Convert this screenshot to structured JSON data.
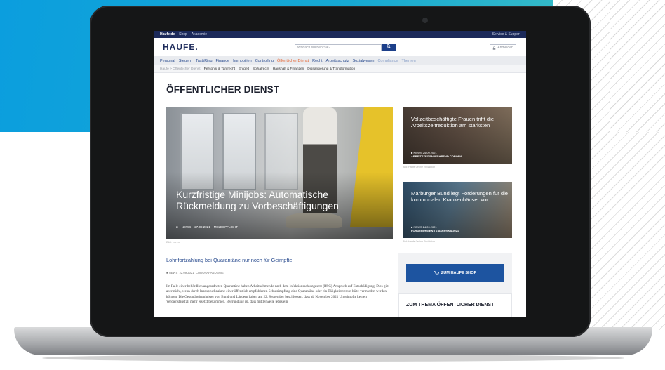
{
  "topbar": {
    "links": [
      "Haufe.de",
      "Shop",
      "Akademie"
    ],
    "right": "Service & Support"
  },
  "header": {
    "logo": "HAUFE.",
    "search_placeholder": "Wonach suchen Sie?",
    "login": "Anmelden"
  },
  "mainnav": {
    "items": [
      "Personal",
      "Steuern",
      "Tax&Ring",
      "Finance",
      "Immobilien",
      "Controlling",
      "Öffentlicher Dienst",
      "Recht",
      "Arbeitsschutz",
      "Sozialwesen",
      "Compliance",
      "Themen"
    ],
    "active_index": 6
  },
  "subnav": {
    "crumb": "Haufe > Öffentlicher Dienst",
    "items": [
      "Personal & Tarifrecht",
      "Entgelt",
      "Sozialrecht",
      "Haushalt & Finanzen",
      "Digitalisierung & Transformation"
    ]
  },
  "page": {
    "title": "ÖFFENTLICHER DIENST"
  },
  "hero": {
    "title": "Kurzfristige Minijobs: Automatische Rückmeldung zu Vorbeschäftigungen",
    "meta_type": "NEWS",
    "meta_date": "27.09.2021",
    "meta_tag": "MELDEPFLICHT",
    "caption": "Bild: Lorem"
  },
  "cards": [
    {
      "title": "Vollzeitbeschäftigte Frauen trifft die Arbeitszeitreduktion am stärksten",
      "meta_type": "NEWS",
      "meta_date": "24.09.2021",
      "meta_tag": "ARBEITSZEITEN WÄHREND CORONA",
      "caption": "Bild: Haufe Online Redaktion"
    },
    {
      "title": "Marburger Bund legt Forderungen für die kommunalen Krankenhäuser vor",
      "meta_type": "NEWS",
      "meta_date": "24.09.2021",
      "meta_tag": "FORDERUNGEN TV-Ärzte/VKA 2021",
      "caption": "Bild: Haufe Online Redaktion"
    }
  ],
  "article": {
    "title": "Lohnfortzahlung bei Quarantäne nur noch für Geimpfte",
    "meta_type": "NEWS",
    "meta_date": "22.09.2021",
    "meta_tag": "CORONAPANDEMIE",
    "body": "Im Falle einer behördlich angeordneten Quarantäne haben Arbeitnehmende nach dem Infektionsschutzgesetz (IfSG) Anspruch auf Entschädigung. Dies gilt aber nicht, wenn durch Inanspruchnahme einer öffentlich empfohlenen Schutzimpfung eine Quarantäne oder ein Tätigkeitsverbot hätte vermieden werden können. Die Gesundheitsminister von Bund und Ländern haben am 22. September beschlossen, dass ab November 2021 Ungeimpfte keinen Verdienstausfall mehr ersetzt bekommen. Begründung ist, dass mittlerweile jedes ein"
  },
  "sidebar": {
    "shop_button": "ZUM HAUFE SHOP",
    "theme_title": "ZUM THEMA ÖFFENTLICHER DIENST"
  },
  "colors": {
    "brand_navy": "#1c2a5a",
    "link_blue": "#2a4c8f",
    "active_orange": "#e5602b",
    "button_blue": "#1d54a0",
    "background_teal": "#0b9ede"
  }
}
